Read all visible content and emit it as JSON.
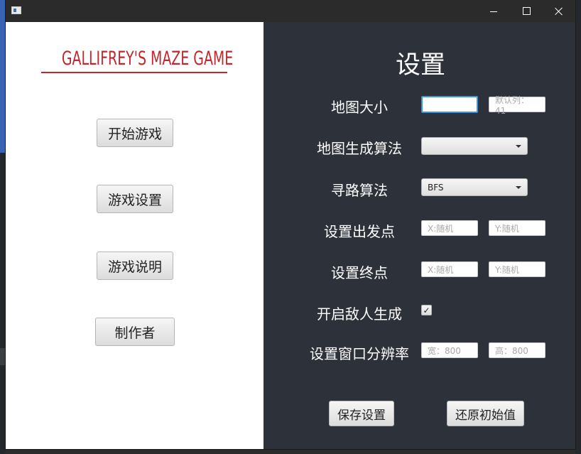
{
  "window": {
    "icon": "java-app-icon",
    "controls": {
      "minimize": "minimize-icon",
      "maximize": "maximize-icon",
      "close": "close-icon"
    }
  },
  "menu": {
    "title": "GALLIFREY'S MAZE GAME",
    "buttons": [
      "开始游戏",
      "游戏设置",
      "游戏说明",
      "制作者"
    ]
  },
  "settings": {
    "title": "设置",
    "map_size": {
      "label": "地图大小",
      "value": "",
      "default_placeholder": "默认列：41"
    },
    "map_algorithm": {
      "label": "地图生成算法",
      "selected": ""
    },
    "path_algorithm": {
      "label": "寻路算法",
      "selected": "BFS"
    },
    "start_point": {
      "label": "设置出发点",
      "x_placeholder": "X:随机",
      "y_placeholder": "Y:随机"
    },
    "end_point": {
      "label": "设置终点",
      "x_placeholder": "X:随机",
      "y_placeholder": "Y:随机"
    },
    "enemy": {
      "label": "开启敌人生成",
      "checked": true,
      "check_glyph": "✓"
    },
    "resolution": {
      "label": "设置窗口分辨率",
      "width_placeholder": "宽：800",
      "height_placeholder": "高：800"
    },
    "save_label": "保存设置",
    "reset_label": "还原初始值"
  },
  "colors": {
    "title_red": "#c0282d",
    "panel_dark": "#2d3139",
    "focus_blue": "#3b95d6"
  }
}
